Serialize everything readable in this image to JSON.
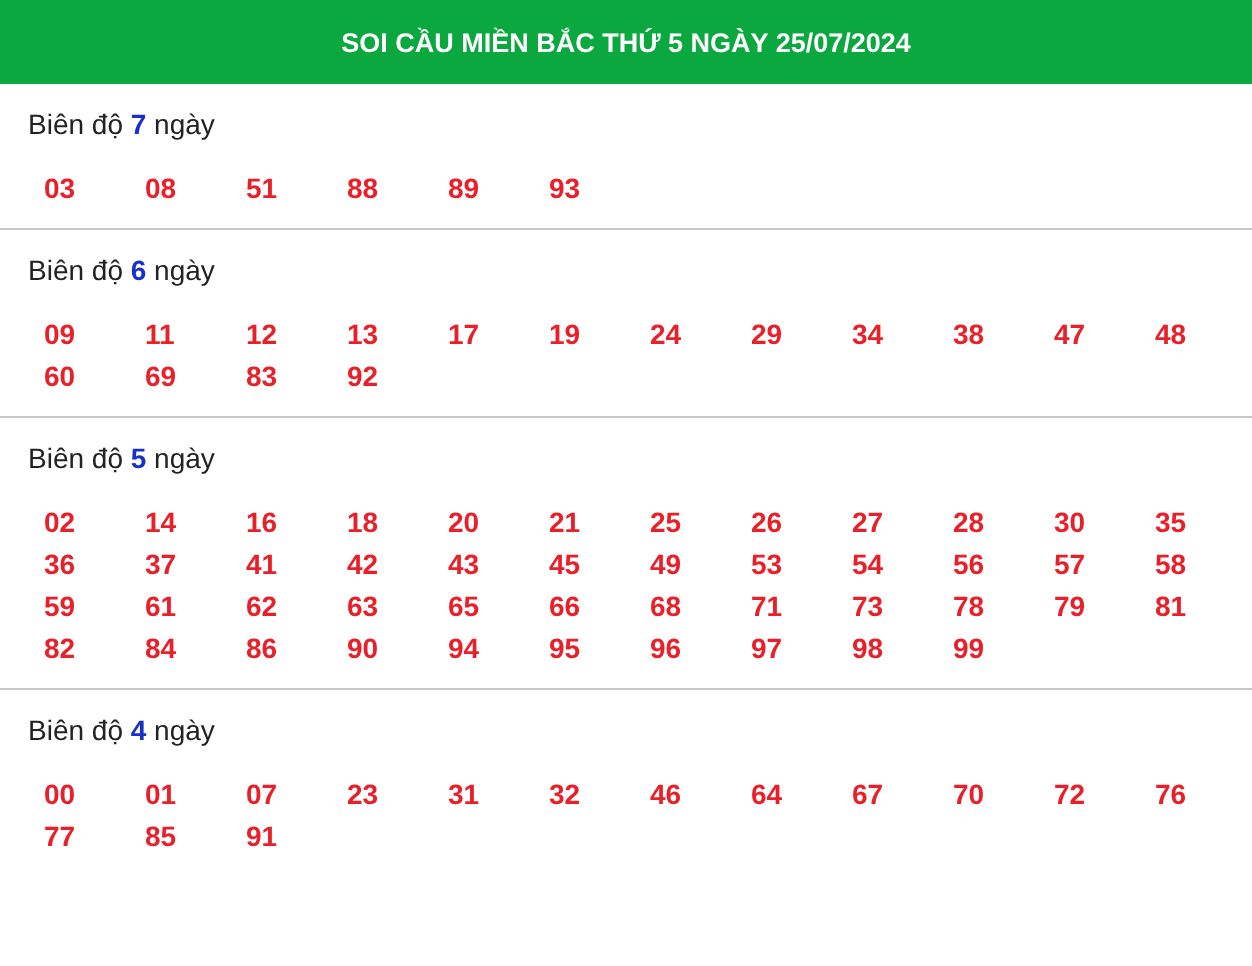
{
  "header": {
    "title": "SOI CẦU MIỀN BẮC THỨ 5 NGÀY 25/07/2024"
  },
  "sections": [
    {
      "title": "Biên độ **7** ngày",
      "numbers": [
        "03",
        "08",
        "51",
        "88",
        "89",
        "93"
      ]
    },
    {
      "title": "Biên độ **6** ngày",
      "numbers": [
        "09",
        "11",
        "12",
        "13",
        "17",
        "19",
        "24",
        "29",
        "34",
        "38",
        "47",
        "48",
        "60",
        "69",
        "83",
        "92"
      ]
    },
    {
      "title": "Biên độ **5** ngày",
      "numbers": [
        "02",
        "14",
        "16",
        "18",
        "20",
        "21",
        "25",
        "26",
        "27",
        "28",
        "30",
        "35",
        "36",
        "37",
        "41",
        "42",
        "43",
        "45",
        "49",
        "53",
        "54",
        "56",
        "57",
        "58",
        "59",
        "61",
        "62",
        "63",
        "65",
        "66",
        "68",
        "71",
        "73",
        "78",
        "79",
        "81",
        "82",
        "84",
        "86",
        "90",
        "94",
        "95",
        "96",
        "97",
        "98",
        "99"
      ]
    },
    {
      "title": "Biên độ **4** ngày",
      "numbers": [
        "00",
        "01",
        "07",
        "23",
        "31",
        "32",
        "46",
        "64",
        "67",
        "70",
        "72",
        "76",
        "77",
        "85",
        "91"
      ]
    }
  ]
}
